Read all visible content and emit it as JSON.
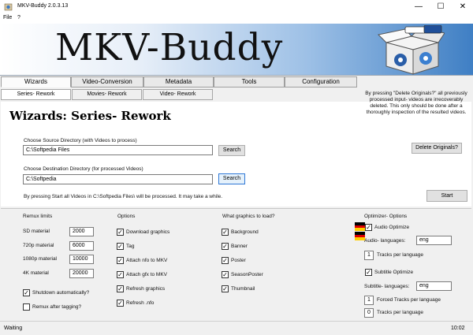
{
  "window": {
    "title": "MKV-Buddy 2.0.3.13",
    "minimize": "—",
    "maximize": "☐",
    "close": "✕"
  },
  "menu": [
    "File",
    "?"
  ],
  "banner": {
    "logo_text": "MKV-Buddy"
  },
  "tabs": [
    "Wizards",
    "Video-Conversion",
    "Metadata",
    "Tools",
    "Configuration"
  ],
  "subtabs": [
    "Series- Rework",
    "Movies- Rework",
    "Video- Rework"
  ],
  "main": {
    "heading": "Wizards:  Series- Rework",
    "source_label": "Choose Source Directory (with Videos to process)",
    "source_value": "C:\\Softpedia Files",
    "dest_label": "Choose Destination Directory (for processed Videos)",
    "dest_value": "C:\\Softpedia",
    "search_label": "Search",
    "info": "By pressing Start all Videos in C:\\Softpedia Files\\ will be processed. It may take a while.",
    "note": "By pressing \"Delete Originals?\" all previously processed input- videos are irrecoverably deleted. This only should be done after a thoroughly inspection of the resulted videos.",
    "delete_label": "Delete Originals?",
    "start_label": "Start"
  },
  "remux": {
    "header": "Remux limits",
    "rows": [
      {
        "label": "SD material",
        "value": "2000"
      },
      {
        "label": "720p material",
        "value": "6000"
      },
      {
        "label": "1080p material",
        "value": "10000"
      },
      {
        "label": "4K material",
        "value": "20000"
      }
    ],
    "shutdown": "Shutdown automatically?",
    "remux_after": "Remux after tagging?"
  },
  "options": {
    "header": "Options",
    "items": [
      "Download graphics",
      "Tag",
      "Attach nfo to MKV",
      "Attach gfx to MKV",
      "Refresh graphics",
      "Refresh .nfo"
    ]
  },
  "graphics": {
    "header": "What graphics to load?",
    "items": [
      "Background",
      "Banner",
      "Poster",
      "SeasonPoster",
      "Thumbnail"
    ]
  },
  "optimizer": {
    "header": "Optimizer- Options",
    "audio_optimize": "Audio Optimize",
    "audio_languages_label": "Audio- languages:",
    "audio_languages_value": "eng",
    "tracks_per_language_value": "1",
    "tracks_per_language_label": "Tracks per language",
    "subtitle_optimize": "Subtitle Optimize",
    "subtitle_languages_label": "Subtitle- languages:",
    "subtitle_languages_value": "eng",
    "forced_tracks_value": "1",
    "forced_tracks_label": "Forced Tracks per language",
    "tracks_value": "0",
    "tracks_label": "Tracks per language"
  },
  "status": {
    "text": "Waiting",
    "time": "10:02"
  },
  "colors": {
    "accent": "#2f78d6",
    "banner_blue": "#3f7fc4",
    "flag_black": "#000000",
    "flag_red": "#dd0000",
    "flag_gold": "#ffce00"
  },
  "icons": {
    "app": "app-icon",
    "check": "check-icon",
    "flag": "german-flag-icon"
  }
}
